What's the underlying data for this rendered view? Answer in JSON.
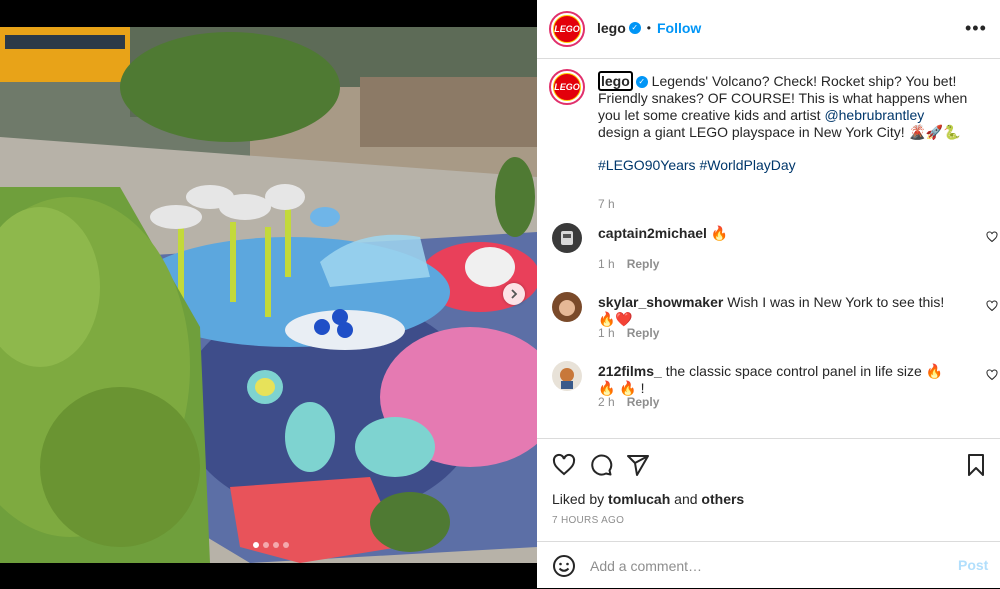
{
  "post": {
    "username": "lego",
    "follow_label": "Follow",
    "bullet": "•",
    "logo_text": "LEGO"
  },
  "caption": {
    "username": "lego",
    "text_part1": "Legends' Volcano? Check! Rocket ship? You bet! Friendly snakes? OF COURSE! This is what happens when you let some creative kids and artist ",
    "mention": "@hebrubrantley",
    "text_part2": " design a giant LEGO playspace in New York City! 🌋🚀🐍",
    "hashtag1": "#LEGO90Years",
    "hashtag2": "#WorldPlayDay",
    "time": "7 h"
  },
  "comments": [
    {
      "user": "captain2michael",
      "text": "🔥",
      "time": "1 h",
      "reply": "Reply"
    },
    {
      "user": "skylar_showmaker",
      "text": "Wish I was in New York to see this! 🔥❤️",
      "time": "1 h",
      "reply": "Reply"
    },
    {
      "user": "212films_",
      "text": "the classic space control panel in life size 🔥 🔥 🔥 !",
      "time": "2 h",
      "reply": "Reply"
    }
  ],
  "likes": {
    "prefix": "Liked by ",
    "user": "tomlucah",
    "middle": " and ",
    "others": "others"
  },
  "timestamp": "7 HOURS AGO",
  "add_comment": {
    "placeholder": "Add a comment…",
    "post_label": "Post"
  },
  "carousel": {
    "total": 4,
    "active": 0
  },
  "colors": {
    "accent": "#0095f6",
    "lego_red": "#e3000b",
    "post_disabled": "#b2dffc"
  }
}
